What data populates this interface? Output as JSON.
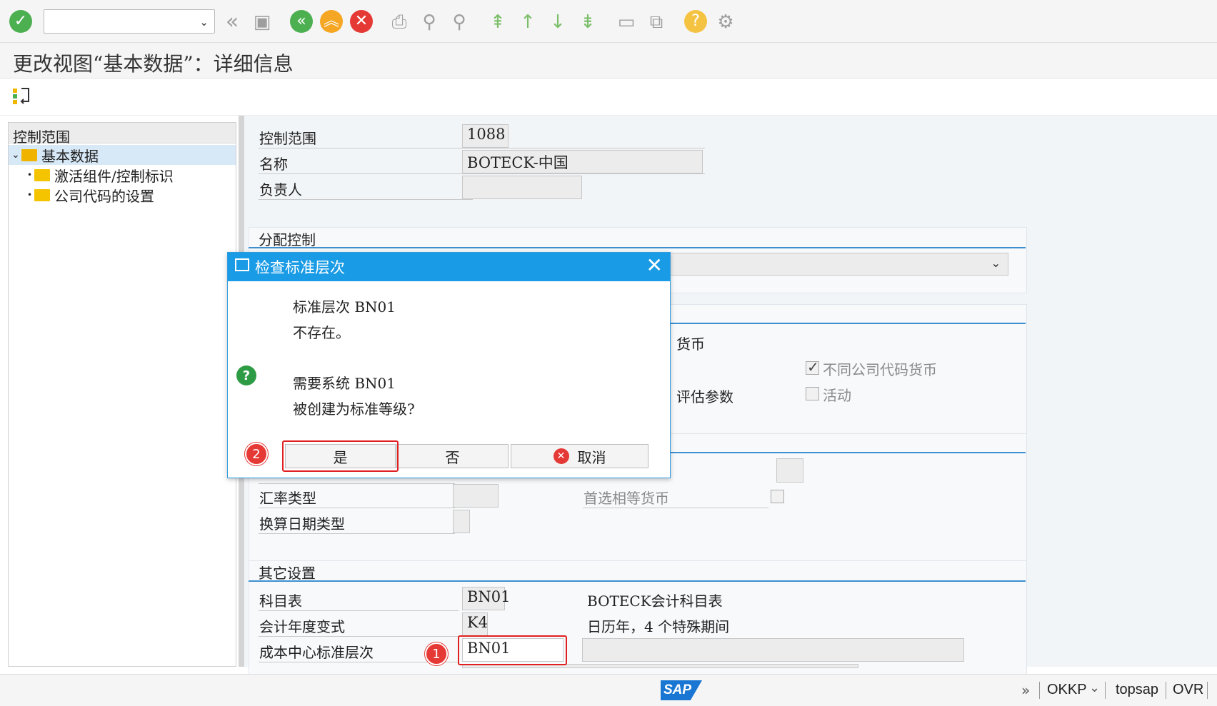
{
  "toolbar": {
    "command_value": "",
    "icons": [
      "enter-icon",
      "back-double-icon",
      "save-icon",
      "back-icon",
      "exit-icon",
      "cancel-icon",
      "print-icon",
      "find-icon",
      "find-next-icon",
      "first-page-icon",
      "prev-page-icon",
      "next-page-icon",
      "last-page-icon",
      "create-session-icon",
      "shortcut-icon",
      "help-icon",
      "settings-icon"
    ]
  },
  "title": "更改视图“基本数据”：详细信息",
  "tree": {
    "header": "控制范围",
    "items": [
      {
        "label": "基本数据",
        "expanded": true,
        "selected": true
      },
      {
        "label": "激活组件/控制标识"
      },
      {
        "label": "公司代码的设置"
      }
    ]
  },
  "form": {
    "top_fields": [
      {
        "label": "控制范围",
        "value": "1088"
      },
      {
        "label": "名称",
        "value": "BOTECK-中国"
      },
      {
        "label": "负责人",
        "value": ""
      }
    ],
    "assignment": {
      "title": "分配控制",
      "select_value": ""
    },
    "currency": {
      "partial_label_1": "货币",
      "partial_label_2": "评估参数",
      "check_diff_currency": {
        "label": "不同公司代码货币",
        "checked": true
      },
      "check_active": {
        "label": "活动",
        "checked": false
      }
    },
    "exchange": {
      "rate_type_label": "汇率类型",
      "rate_type_value": "",
      "trans_date_label": "换算日期类型",
      "trans_date_value": "",
      "pref_currency_label": "首选相等货币"
    },
    "other": {
      "title": "其它设置",
      "rows": [
        {
          "label": "科目表",
          "value": "BN01",
          "desc": "BOTECK会计科目表"
        },
        {
          "label": "会计年度变式",
          "value": "K4",
          "desc": "日历年，4 个特殊期间"
        },
        {
          "label": "成本中心标准层次",
          "value": "BN01",
          "desc": ""
        }
      ]
    }
  },
  "dialog": {
    "title": "检查标准层次",
    "line1": "标准层次 BN01",
    "line2": "不存在。",
    "line3": "需要系统 BN01",
    "line4": "被创建为标准等级?",
    "yes": "是",
    "no": "否",
    "cancel": "取消"
  },
  "badges": {
    "one": "1",
    "two": "2"
  },
  "status": {
    "brand": "SAP",
    "tcode": "OKKP",
    "server": "topsap",
    "mode": "OVR"
  }
}
